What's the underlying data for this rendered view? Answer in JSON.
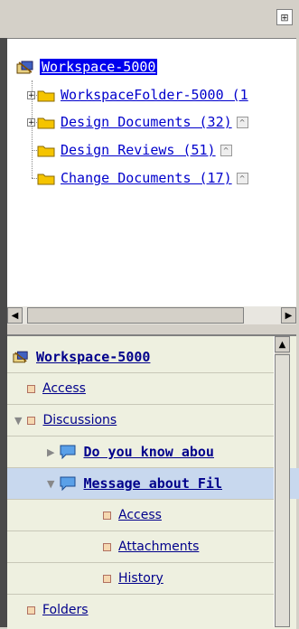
{
  "toolbar": {
    "icon": "hierarchy-icon"
  },
  "tree": {
    "root_label": "Workspace-5000",
    "items": [
      {
        "label": "WorkspaceFolder-5000 (1",
        "expandable": true
      },
      {
        "label": "Design Documents (32)",
        "expandable": true
      },
      {
        "label": "Design Reviews (51)",
        "expandable": false
      },
      {
        "label": "Change Documents (17)",
        "expandable": false
      }
    ]
  },
  "lower": {
    "root_label": "Workspace-5000",
    "items": [
      {
        "label": "Access"
      },
      {
        "label": "Discussions"
      },
      {
        "label": "Do you know abou"
      },
      {
        "label": "Message about Fil"
      },
      {
        "label": "Access"
      },
      {
        "label": "Attachments"
      },
      {
        "label": "History"
      },
      {
        "label": "Folders"
      }
    ]
  },
  "colors": {
    "selection": "#0000ee",
    "link": "#0000cc",
    "lower_bg": "#eef0e0"
  }
}
